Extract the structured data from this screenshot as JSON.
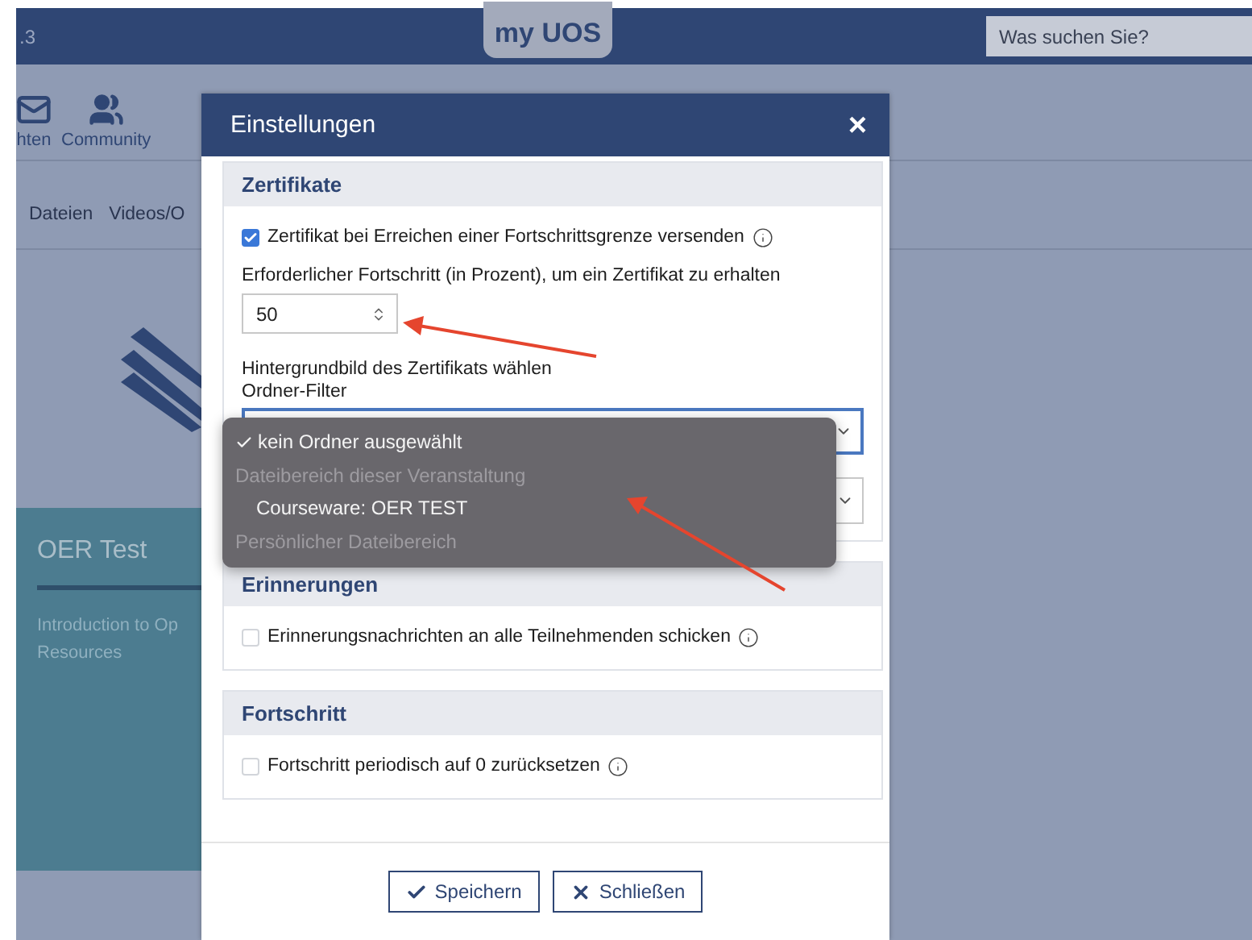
{
  "header": {
    "version": ".3",
    "logo": "my UOS",
    "search": {
      "placeholder": "Was suchen Sie?"
    }
  },
  "nav": [
    {
      "label": "hten"
    },
    {
      "label": "Community"
    }
  ],
  "tabs": [
    {
      "label": "Dateien"
    },
    {
      "label": "Videos/O"
    }
  ],
  "course_card": {
    "title": "OER Test",
    "description_lines": [
      "Introduction to Op",
      "Resources"
    ]
  },
  "dialog": {
    "title": "Einstellungen",
    "close": "×",
    "sections": [
      {
        "title": "Zertifikate",
        "fields": [
          {
            "kind": "checkbox",
            "label": "Zertifikat bei Erreichen einer Fortschrittsgrenze versenden",
            "checked": true
          },
          {
            "kind": "number",
            "label": "Erforderlicher Fortschritt (in Prozent), um ein Zertifikat zu erhalten",
            "value": "50"
          },
          {
            "kind": "text",
            "label": "Hintergrundbild des Zertifikats wählen"
          },
          {
            "kind": "select",
            "label": "Ordner-Filter",
            "focused": true
          },
          {
            "kind": "select",
            "focused": false
          }
        ]
      },
      {
        "title": "Erinnerungen",
        "fields": [
          {
            "kind": "checkbox",
            "label": "Erinnerungsnachrichten an alle Teilnehmenden schicken",
            "checked": false
          }
        ]
      },
      {
        "title": "Fortschritt",
        "fields": [
          {
            "kind": "checkbox",
            "label": "Fortschritt periodisch auf 0 zurücksetzen",
            "checked": false
          }
        ]
      }
    ],
    "dropdown": [
      {
        "label": "kein Ordner ausgewählt",
        "selected": true,
        "disabled": false
      },
      {
        "label": "Dateibereich dieser Veranstaltung",
        "selected": false,
        "disabled": true,
        "children": [
          {
            "label": "Courseware: OER TEST",
            "selected": false,
            "disabled": false
          }
        ]
      },
      {
        "label": "Persönlicher Dateibereich",
        "selected": false,
        "disabled": true
      }
    ],
    "buttons": [
      {
        "label": "Speichern"
      },
      {
        "label": "Schließen"
      }
    ]
  }
}
